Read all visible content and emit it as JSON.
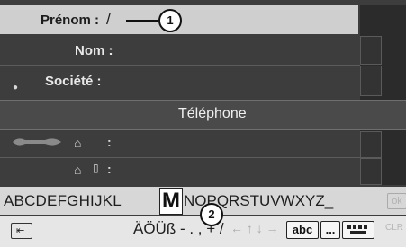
{
  "contact_form": {
    "prenom_label": "Prénom :",
    "prenom_value": "/",
    "nom_label": "Nom :",
    "societe_label": "Société :",
    "telephone_section": "Téléphone",
    "home_phone_label": ":",
    "home_mobile_label": ":"
  },
  "callouts": {
    "first": "1",
    "second": "2"
  },
  "keyboard": {
    "alpha_before": "ABCDEFGHIJKL",
    "selected_letter": "M",
    "alpha_after": "NOPQRSTUVWXYZ_",
    "ok_label": "ok",
    "special_chars": "ÄÖÜß - . , + /",
    "arrow_chars": "← ↑ ↓ →",
    "abc_label": "abc",
    "ellipsis_label": "...",
    "clr_label": "CLR"
  },
  "icons": {
    "home": "house-icon",
    "mobile": "mobile-phone-icon",
    "back": "back-icon",
    "person": "person-icon",
    "telephone": "handset-icon",
    "symbols": "symbol-keyboard-icon"
  },
  "colors": {
    "screen_background": "#3d3d3d",
    "active_field": "#cfcfcf",
    "keyboard_background": "#d7d7d7"
  }
}
